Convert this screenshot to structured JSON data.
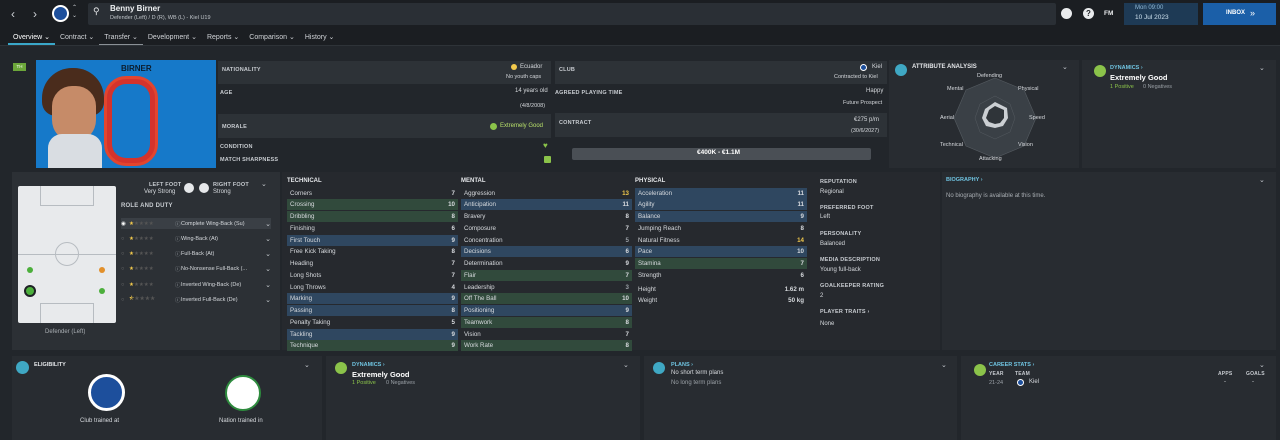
{
  "header": {
    "player_name": "Benny Birner",
    "player_sub": "Defender (Left) / D (R), WB (L) - Kiel U19",
    "time": "Mon 09:00",
    "date": "10 Jul 2023",
    "fm": "FM",
    "inbox": "INBOX"
  },
  "tabs": [
    {
      "label": "Overview ⌄"
    },
    {
      "label": "Contract ⌄"
    },
    {
      "label": "Transfer ⌄"
    },
    {
      "label": "Development ⌄"
    },
    {
      "label": "Reports ⌄"
    },
    {
      "label": "Comparison ⌄"
    },
    {
      "label": "History ⌄"
    }
  ],
  "profile": {
    "surname": "BIRNER",
    "shirt": "0",
    "badge": "TH"
  },
  "info": {
    "nationality_label": "NATIONALITY",
    "nationality": "Ecuador",
    "youth_caps": "No youth caps",
    "age_label": "AGE",
    "age": "14 years old",
    "dob": "(4/8/2008)",
    "morale_label": "MORALE",
    "morale": "Extremely Good",
    "condition_label": "CONDITION",
    "sharpness_label": "MATCH SHARPNESS",
    "club_label": "CLUB",
    "club": "Kiel",
    "contracted": "Contracted to Kiel",
    "apt_label": "AGREED PLAYING TIME",
    "apt": "Happy",
    "apt_sub": "Future Prospect",
    "contract_label": "CONTRACT",
    "wage": "€275 p/m",
    "expiry": "(30/6/2027)",
    "value": "€400K - €1.1M"
  },
  "attr_analysis": {
    "title": "ATTRIBUTE ANALYSIS",
    "axes": [
      "Defending",
      "Physical",
      "Speed",
      "Vision",
      "Attacking",
      "Technical",
      "Aerial",
      "Mental"
    ]
  },
  "dynamics": {
    "title": "DYNAMICS ›",
    "value": "Extremely Good",
    "positive": "1 Positive",
    "negative": "0 Negatives"
  },
  "positions": {
    "left_foot_label": "LEFT FOOT",
    "left_foot": "Very Strong",
    "right_foot_label": "RIGHT FOOT",
    "right_foot": "Strong",
    "pitch_caption": "Defender (Left)",
    "role_title": "ROLE AND DUTY",
    "roles": [
      {
        "name": "Complete Wing-Back (Su)"
      },
      {
        "name": "Wing-Back (At)"
      },
      {
        "name": "Full-Back (At)"
      },
      {
        "name": "No-Nonsense Full-Back (..."
      },
      {
        "name": "Inverted Wing-Back (De)"
      },
      {
        "name": "Inverted Full-Back (De)"
      }
    ]
  },
  "technical": {
    "title": "TECHNICAL",
    "rows": [
      {
        "n": "Corners",
        "v": "7"
      },
      {
        "n": "Crossing",
        "v": "10"
      },
      {
        "n": "Dribbling",
        "v": "8"
      },
      {
        "n": "Finishing",
        "v": "6"
      },
      {
        "n": "First Touch",
        "v": "9"
      },
      {
        "n": "Free Kick Taking",
        "v": "8"
      },
      {
        "n": "Heading",
        "v": "7"
      },
      {
        "n": "Long Shots",
        "v": "7"
      },
      {
        "n": "Long Throws",
        "v": "4"
      },
      {
        "n": "Marking",
        "v": "9"
      },
      {
        "n": "Passing",
        "v": "8"
      },
      {
        "n": "Penalty Taking",
        "v": "5"
      },
      {
        "n": "Tackling",
        "v": "9"
      },
      {
        "n": "Technique",
        "v": "9"
      }
    ]
  },
  "mental": {
    "title": "MENTAL",
    "rows": [
      {
        "n": "Aggression",
        "v": "13"
      },
      {
        "n": "Anticipation",
        "v": "11"
      },
      {
        "n": "Bravery",
        "v": "8"
      },
      {
        "n": "Composure",
        "v": "7"
      },
      {
        "n": "Concentration",
        "v": "5"
      },
      {
        "n": "Decisions",
        "v": "6"
      },
      {
        "n": "Determination",
        "v": "9"
      },
      {
        "n": "Flair",
        "v": "7"
      },
      {
        "n": "Leadership",
        "v": "3"
      },
      {
        "n": "Off The Ball",
        "v": "10"
      },
      {
        "n": "Positioning",
        "v": "9"
      },
      {
        "n": "Teamwork",
        "v": "8"
      },
      {
        "n": "Vision",
        "v": "7"
      },
      {
        "n": "Work Rate",
        "v": "8"
      }
    ]
  },
  "physical": {
    "title": "PHYSICAL",
    "rows": [
      {
        "n": "Acceleration",
        "v": "11"
      },
      {
        "n": "Agility",
        "v": "11"
      },
      {
        "n": "Balance",
        "v": "9"
      },
      {
        "n": "Jumping Reach",
        "v": "8"
      },
      {
        "n": "Natural Fitness",
        "v": "14"
      },
      {
        "n": "Pace",
        "v": "10"
      },
      {
        "n": "Stamina",
        "v": "7"
      },
      {
        "n": "Strength",
        "v": "6"
      }
    ],
    "height_label": "Height",
    "height": "1.62 m",
    "weight_label": "Weight",
    "weight": "50 kg"
  },
  "side": {
    "reputation_label": "REPUTATION",
    "reputation": "Regional",
    "foot_label": "PREFERRED FOOT",
    "foot": "Left",
    "personality_label": "PERSONALITY",
    "personality": "Balanced",
    "media_label": "MEDIA DESCRIPTION",
    "media": "Young full-back",
    "gk_label": "GOALKEEPER RATING",
    "gk": "2",
    "traits_label": "PLAYER TRAITS ›",
    "traits": "None"
  },
  "biography": {
    "title": "BIOGRAPHY ›",
    "text": "No biography is available at this time."
  },
  "eligibility": {
    "title": "ELIGIBILITY",
    "club_caption": "Club trained at",
    "nation_caption": "Nation trained in"
  },
  "plans": {
    "title": "PLANS ›",
    "short": "No short term plans",
    "long": "No long term plans"
  },
  "career": {
    "title": "CAREER STATS ›",
    "year_h": "YEAR",
    "team_h": "TEAM",
    "apps_h": "APPS",
    "goals_h": "GOALS",
    "year": "21-24",
    "team": "Kiel",
    "apps": "-",
    "goals": "-"
  }
}
